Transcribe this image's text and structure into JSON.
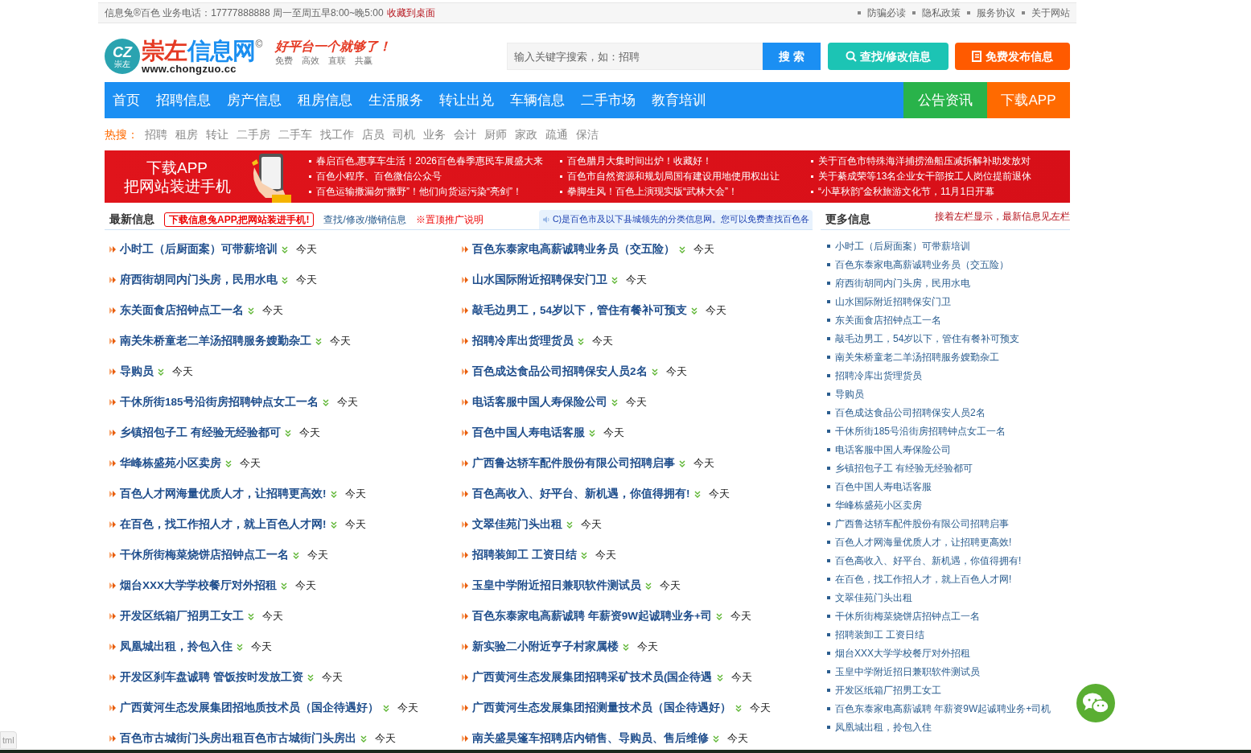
{
  "top_bar": {
    "info": "信息兔®百色 业务电话：17777888888 周一至周五早8:00~晚5:00",
    "bookmark": "收藏到桌面",
    "links": [
      "防骗必读",
      "隐私政策",
      "服务协议",
      "关于网站"
    ]
  },
  "header": {
    "logo_badge": "CZ",
    "logo_badge_sub": "崇左",
    "logo_red": "崇左",
    "logo_blue": "信息网",
    "logo_mark": "©",
    "logo_url": "www.chongzuo.cc",
    "slogan": "好平台一个就够了！",
    "slogan_sub": "免费　高效　直联　共赢",
    "search_placeholder": "输入关键字搜索，如：招聘",
    "search_button": "搜 索",
    "find_button": "查找/修改信息",
    "post_button": "免费发布信息"
  },
  "nav": [
    {
      "label": "首页",
      "kind": "main"
    },
    {
      "label": "招聘信息",
      "kind": "main"
    },
    {
      "label": "房产信息",
      "kind": "main"
    },
    {
      "label": "租房信息",
      "kind": "main"
    },
    {
      "label": "生活服务",
      "kind": "main"
    },
    {
      "label": "转让出兑",
      "kind": "main"
    },
    {
      "label": "车辆信息",
      "kind": "main"
    },
    {
      "label": "二手市场",
      "kind": "main"
    },
    {
      "label": "教育培训",
      "kind": "main"
    },
    {
      "label": "公告资讯",
      "kind": "notice"
    },
    {
      "label": "下载APP",
      "kind": "app"
    }
  ],
  "hot_search": {
    "label": "热搜：",
    "terms": [
      "招聘",
      "租房",
      "转让",
      "二手房",
      "二手车",
      "找工作",
      "店员",
      "司机",
      "业务",
      "会计",
      "厨师",
      "家政",
      "疏通",
      "保洁"
    ]
  },
  "banner": {
    "lines": [
      "下载APP",
      "把网站装进手机"
    ],
    "columns": [
      [
        "春启百色,惠享车生活！2026百色春季惠民车展盛大来",
        "百色小程序、百色微信公众号",
        "百色运输撒漏勿“撒野”！他们向货运污染“亮剑”！"
      ],
      [
        "百色腊月大集时间出炉！收藏好！",
        "百色市自然资源和规划局国有建设用地使用权出让",
        "拳脚生风！百色上演现实版“武林大会”！"
      ],
      [
        "关于百色市特殊海洋捕捞渔船压减拆解补助发放对",
        "关于綦成荣等13名企业女干部按工人岗位提前退休",
        "“小草秋韵”金秋旅游文化节，11月1日开幕"
      ]
    ]
  },
  "latest": {
    "title": "最新信息",
    "app_link": "下载信息兔APP,把网站装进手机!",
    "manage_link": "查找/修改/撤销信息",
    "top_link": "※置顶推广说明",
    "notice": "C)是百色市及以下县城领先的分类信息网。您可以免费查找百色各",
    "items": [
      {
        "title": "小时工（后厨面案）可带薪培训",
        "time": "今天"
      },
      {
        "title": "百色东泰家电高薪诚聘业务员（交五险）",
        "time": "今天"
      },
      {
        "title": "府西街胡同内门头房，民用水电",
        "time": "今天"
      },
      {
        "title": "山水国际附近招聘保安门卫",
        "time": "今天"
      },
      {
        "title": "东关面食店招钟点工一名",
        "time": "今天"
      },
      {
        "title": "敲毛边男工，54岁以下，管住有餐补可预支",
        "time": "今天"
      },
      {
        "title": "南关朱桥童老二羊汤招聘服务嫂勤杂工",
        "time": "今天"
      },
      {
        "title": "招聘冷库出货理货员",
        "time": "今天"
      },
      {
        "title": "导购员",
        "time": "今天"
      },
      {
        "title": "百色成达食品公司招聘保安人员2名",
        "time": "今天"
      },
      {
        "title": "干休所街185号沿街房招聘钟点女工一名",
        "time": "今天"
      },
      {
        "title": "电话客服中国人寿保险公司",
        "time": "今天"
      },
      {
        "title": "乡镇招包子工 有经验无经验都可",
        "time": "今天"
      },
      {
        "title": "百色中国人寿电话客服",
        "time": "今天"
      },
      {
        "title": "华峰栋盛苑小区卖房",
        "time": "今天"
      },
      {
        "title": "广西鲁达轿车配件股份有限公司招聘启事",
        "time": "今天"
      },
      {
        "title": "百色人才网海量优质人才，让招聘更高效!",
        "time": "今天"
      },
      {
        "title": "百色高收入、好平台、新机遇，你值得拥有!",
        "time": "今天"
      },
      {
        "title": "在百色，找工作招人才，就上百色人才网!",
        "time": "今天"
      },
      {
        "title": "文翠佳苑门头出租",
        "time": "今天"
      },
      {
        "title": "干休所街梅菜烧饼店招钟点工一名",
        "time": "今天"
      },
      {
        "title": "招聘装卸工 工资日结",
        "time": "今天"
      },
      {
        "title": "烟台XXX大学学校餐厅对外招租",
        "time": "今天"
      },
      {
        "title": "玉皇中学附近招日兼职软件测试员",
        "time": "今天"
      },
      {
        "title": "开发区纸箱厂招男工女工",
        "time": "今天"
      },
      {
        "title": "百色东泰家电高薪诚聘 年薪资9W起诚聘业务+司",
        "time": "今天"
      },
      {
        "title": "凤凰城出租，拎包入住",
        "time": "今天"
      },
      {
        "title": "新实验二小附近亨子村家属楼",
        "time": "今天"
      },
      {
        "title": "开发区刹车盘诚聘 管饭按时发放工资",
        "time": "今天"
      },
      {
        "title": "广西黄河生态发展集团招聘采矿技术员(国企待遇",
        "time": "今天"
      },
      {
        "title": "广西黄河生态发展集团招地质技术员（国企待遇好）",
        "time": "今天"
      },
      {
        "title": "广西黄河生态发展集团招测量技术员（国企待遇好）",
        "time": "今天"
      },
      {
        "title": "百色市古城街门头房出租百色市古城街门头房出",
        "time": "今天"
      },
      {
        "title": "南关盛昊篷车招聘店内销售、导购员、售后维修",
        "time": "今天"
      }
    ]
  },
  "more": {
    "title": "更多信息",
    "hint": "接着左栏显示，最新信息见左栏",
    "items": [
      "小时工（后厨面案）可带薪培训",
      "百色东泰家电高薪诚聘业务员（交五险）",
      "府西街胡同内门头房，民用水电",
      "山水国际附近招聘保安门卫",
      "东关面食店招钟点工一名",
      "敲毛边男工，54岁以下，管住有餐补可预支",
      "南关朱桥童老二羊汤招聘服务嫂勤杂工",
      "招聘冷库出货理货员",
      "导购员",
      "百色成达食品公司招聘保安人员2名",
      "干休所街185号沿街房招聘钟点女工一名",
      "电话客服中国人寿保险公司",
      "乡镇招包子工 有经验无经验都可",
      "百色中国人寿电话客服",
      "华峰栋盛苑小区卖房",
      "广西鲁达轿车配件股份有限公司招聘启事",
      "百色人才网海量优质人才，让招聘更高效!",
      "百色高收入、好平台、新机遇，你值得拥有!",
      "在百色，找工作招人才，就上百色人才网!",
      "文翠佳苑门头出租",
      "干休所街梅菜烧饼店招钟点工一名",
      "招聘装卸工 工资日结",
      "烟台XXX大学学校餐厅对外招租",
      "玉皇中学附近招日兼职软件测试员",
      "开发区纸箱厂招男工女工",
      "百色东泰家电高薪诚聘 年薪资9W起诚聘业务+司机",
      "凤凰城出租，拎包入住"
    ]
  },
  "status_tooltip": "tml"
}
